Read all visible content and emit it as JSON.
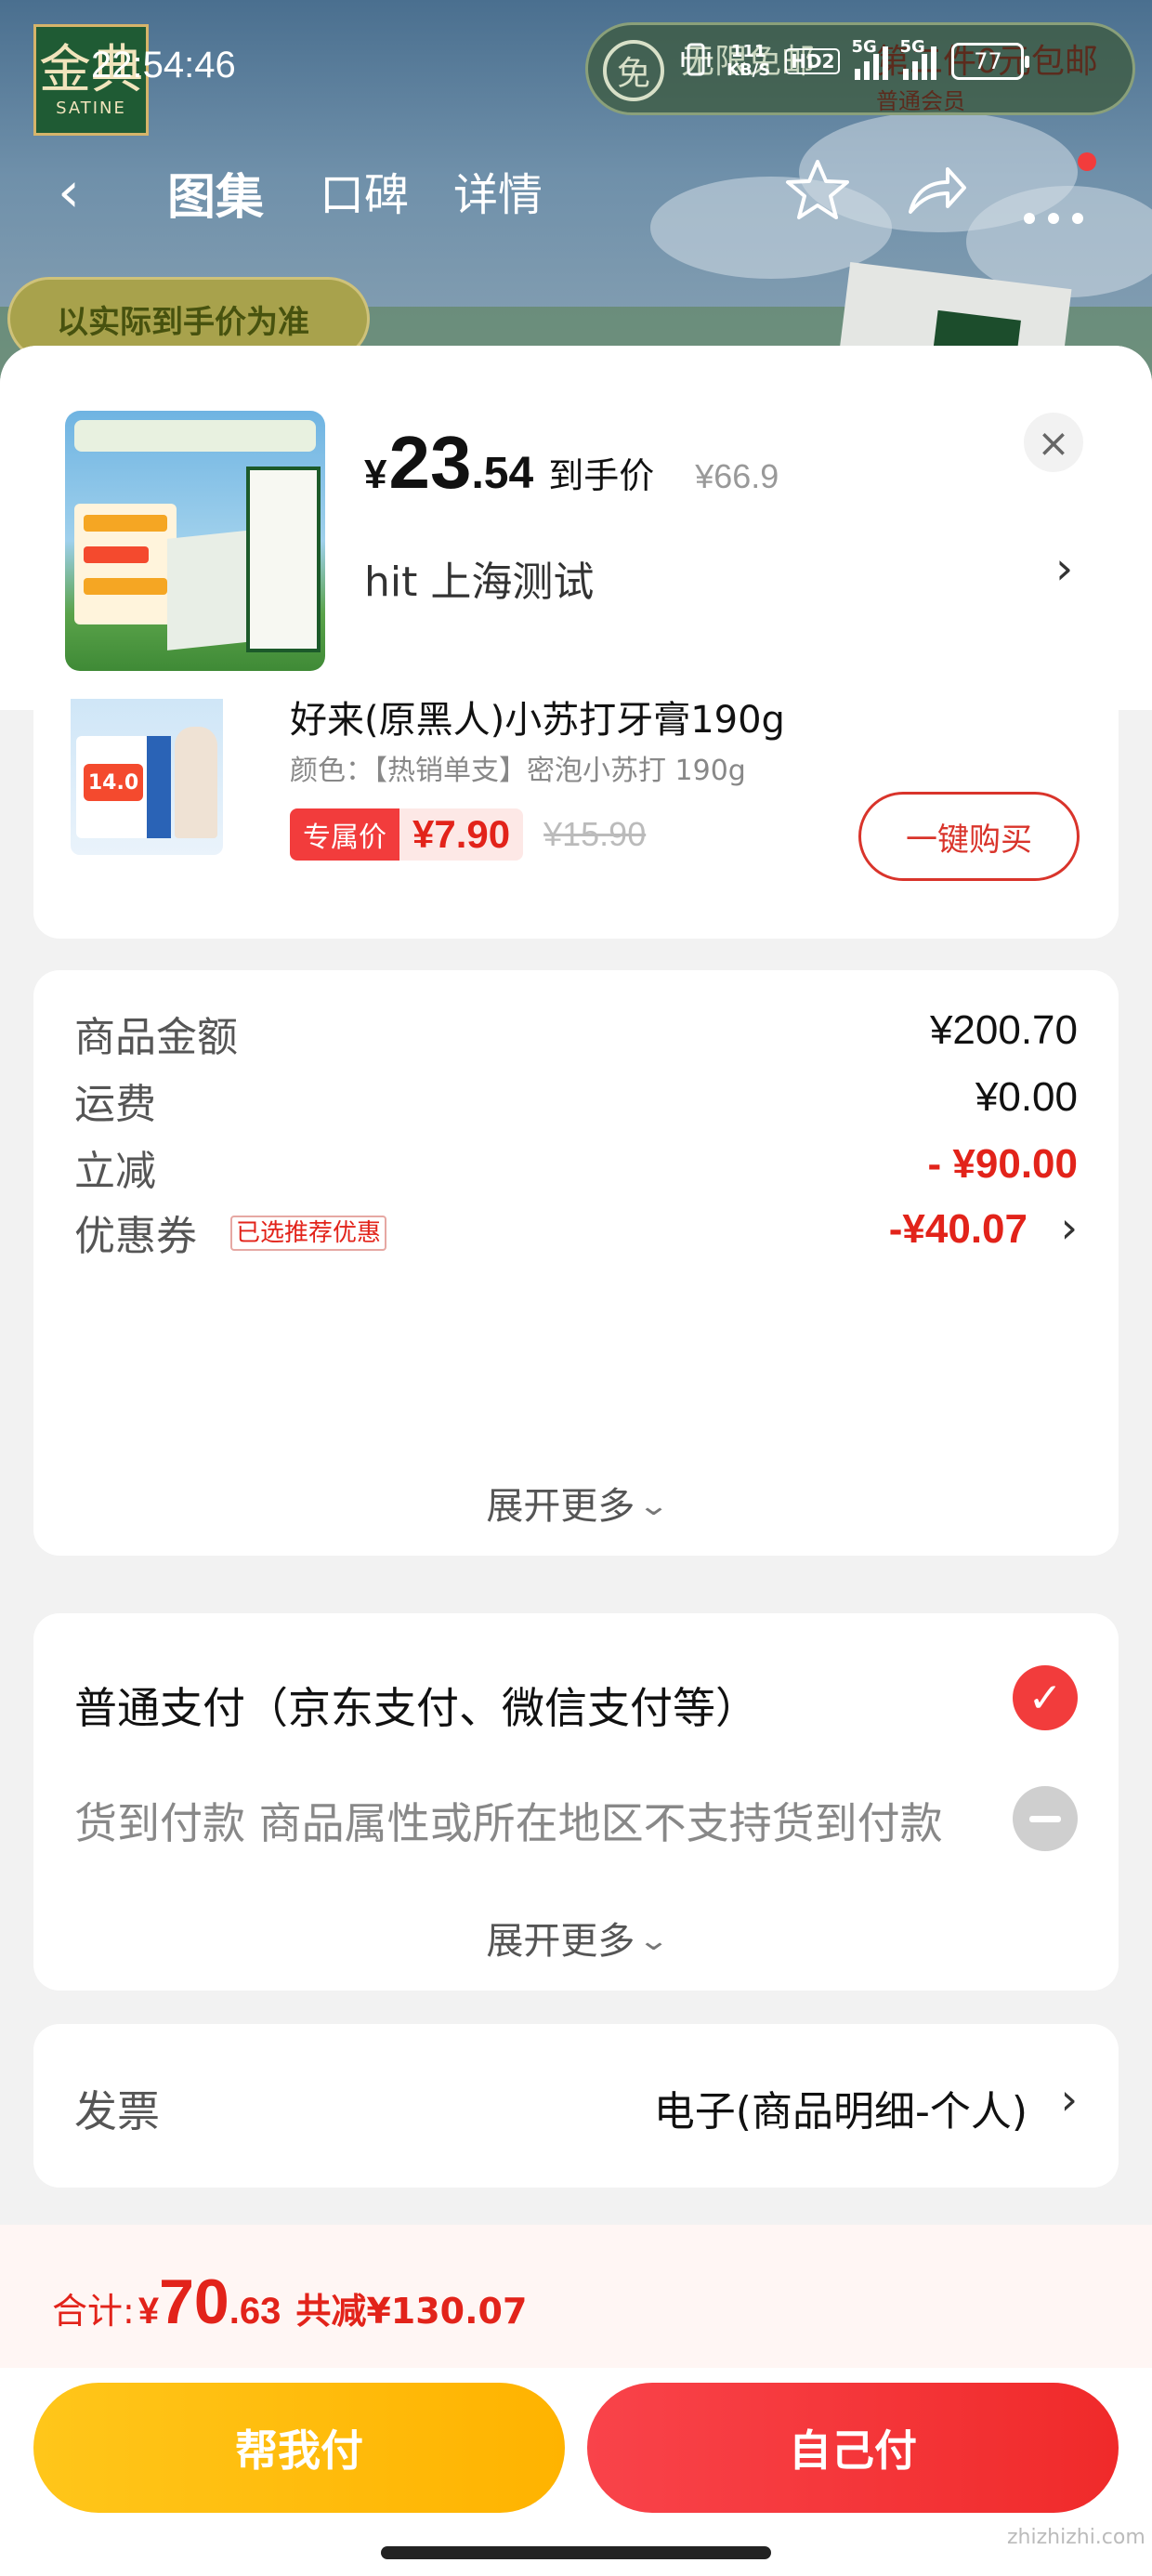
{
  "status_bar": {
    "time": "22:54:46",
    "net_speed_value": "111",
    "net_speed_unit": "KB/S",
    "hd_label": "HD2",
    "sig1_label": "5G",
    "sig2_label": "5G",
    "battery": "77"
  },
  "background": {
    "brand_big": "金典",
    "brand_small": "SATINE",
    "free_icon": "免",
    "promo_left": "无限免邮",
    "promo_right": "第二件0元包邮",
    "promo_right_sub": "普通会员",
    "price_badge": "以实际到手价为准"
  },
  "nav": {
    "back_icon": "chevron-left-icon",
    "tabs": [
      "图集",
      "口碑",
      "详情"
    ],
    "active_tab": 0,
    "star_icon": "star-icon",
    "share_icon": "share-icon",
    "more_icon": "more-icon"
  },
  "product": {
    "price_symbol": "¥",
    "price_int": "23",
    "price_dec": ".54",
    "price_label": "到手价",
    "orig_price": "¥66.9",
    "address": "hit  上海测试",
    "close_icon": "close-icon"
  },
  "recommend": {
    "title": "好来(原黑人)小苏打牙膏190g",
    "spec": "颜色：【热销单支】密泡小苏打 190g",
    "badge": "专属价",
    "price": "¥7.90",
    "orig_price": "¥15.90",
    "buy_label": "一键购买",
    "img_badge": "14.0"
  },
  "summary": {
    "rows": [
      {
        "label": "商品金额",
        "value": "¥200.70"
      },
      {
        "label": "运费",
        "value": "¥0.00"
      },
      {
        "label": "立减",
        "value": "- ¥90.00"
      },
      {
        "label": "优惠券",
        "value": "-¥40.07",
        "tag": "已选推荐优惠"
      }
    ],
    "expand_label": "展开更多"
  },
  "payment": {
    "option1": "普通支付（京东支付、微信支付等）",
    "option2": "货到付款 商品属性或所在地区不支持货到付款",
    "expand_label": "展开更多"
  },
  "invoice": {
    "label": "发票",
    "value": "电子(商品明细-个人)"
  },
  "footer": {
    "total_label": "合计:",
    "total_symbol": "¥",
    "total_int": "70",
    "total_dec": ".63",
    "saved": "共减¥130.07",
    "help_pay": "帮我付",
    "self_pay": "自己付",
    "watermark": "zhizhizhi.com"
  },
  "colors": {
    "accent_red": "#e2231a",
    "button_red": "#f23c3c",
    "button_yellow": "#ffc61a"
  }
}
